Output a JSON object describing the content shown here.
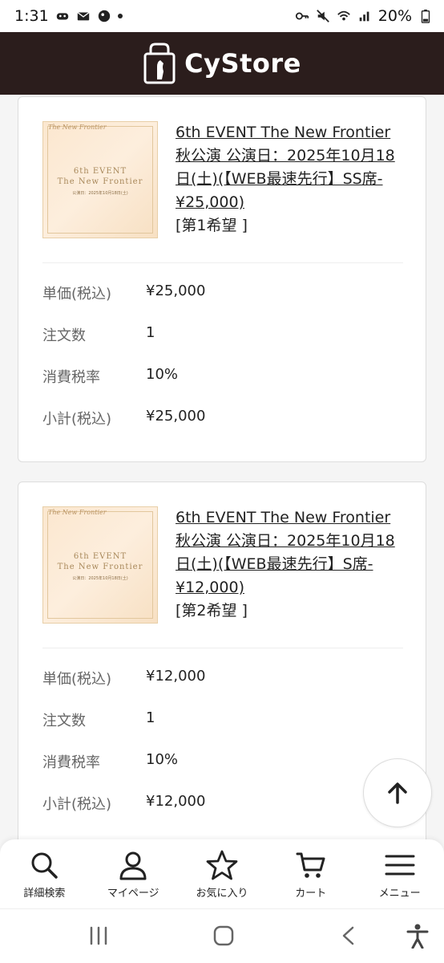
{
  "status_bar": {
    "time": "1:31",
    "battery": "20%"
  },
  "header": {
    "brand": "CyStore"
  },
  "items": [
    {
      "thumb": {
        "mini_logo": "The New Frontier",
        "line1": "6th EVENT",
        "line2": "The New Frontier",
        "line3": "公演日：2025年10月18日(土)"
      },
      "title": "6th EVENT The New Frontier 秋公演 公演日：2025年10月18日(土)(【WEB最速先行】SS席-¥25,000)",
      "preference": "[第1希望 ]",
      "rows": [
        {
          "label": "単価(税込)",
          "value": "¥25,000"
        },
        {
          "label": "注文数",
          "value": "1"
        },
        {
          "label": "消費税率",
          "value": "10%"
        },
        {
          "label": "小計(税込)",
          "value": "¥25,000"
        }
      ]
    },
    {
      "thumb": {
        "mini_logo": "The New Frontier",
        "line1": "6th EVENT",
        "line2": "The New Frontier",
        "line3": "公演日：2025年10月18日(土)"
      },
      "title": "6th EVENT The New Frontier 秋公演 公演日：2025年10月18日(土)(【WEB最速先行】S席-¥12,000)",
      "preference": "[第2希望 ]",
      "rows": [
        {
          "label": "単価(税込)",
          "value": "¥12,000"
        },
        {
          "label": "注文数",
          "value": "1"
        },
        {
          "label": "消費税率",
          "value": "10%"
        },
        {
          "label": "小計(税込)",
          "value": "¥12,000"
        }
      ]
    }
  ],
  "bottom_nav": [
    {
      "label": "詳細検索",
      "icon": "search-icon"
    },
    {
      "label": "マイページ",
      "icon": "user-icon"
    },
    {
      "label": "お気に入り",
      "icon": "star-icon"
    },
    {
      "label": "カート",
      "icon": "cart-icon"
    },
    {
      "label": "メニュー",
      "icon": "menu-icon"
    }
  ],
  "colors": {
    "header_bg": "#2b1d1c",
    "card_bg": "#ffffff",
    "page_bg": "#f5f5f5",
    "thumb_bg": "#fbe7cf"
  }
}
